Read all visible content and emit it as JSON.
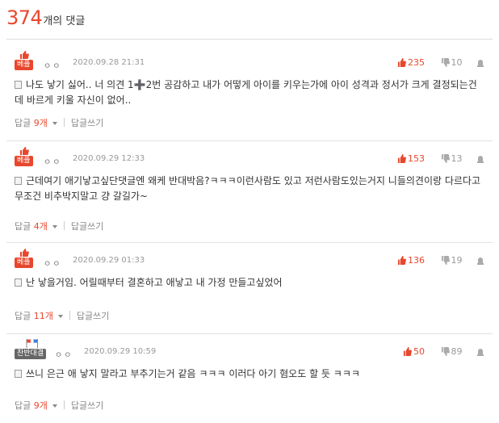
{
  "header": {
    "count": "374",
    "count_label": "개의 댓글"
  },
  "colors": {
    "accent": "#e8472d",
    "muted": "#999999"
  },
  "comments": [
    {
      "badge": "베플",
      "badge_type": "best",
      "badge_icon": "thumbs-up-icon",
      "author": "ㅇㅇ",
      "date": "2020.09.28 21:31",
      "likes": "235",
      "dislikes": "10",
      "text": "나도 낳기 싫어.. 너 의견 1➕2번 공감하고 내가 어떻게 아이를 키우는가에 아이 성격과 정서가 크게 결정되는건데 바르게 키울 자신이 없어..",
      "reply_label": "답글",
      "reply_count": "9개",
      "write_reply": "답글쓰기"
    },
    {
      "badge": "베플",
      "badge_type": "best",
      "badge_icon": "thumbs-up-icon",
      "author": "ㅇㅇ",
      "date": "2020.09.29 12:33",
      "likes": "153",
      "dislikes": "13",
      "text": "근데여기 애기낳고싶단댓글엔 왜케 반대박음?ㅋㅋㅋ이런사람도 있고 저런사람도있는거지 니들의견이랑 다르다고 무조건 비추박지말고 걍 갈길가~",
      "reply_label": "답글",
      "reply_count": "4개",
      "write_reply": "답글쓰기"
    },
    {
      "badge": "베플",
      "badge_type": "best",
      "badge_icon": "thumbs-up-icon",
      "author": "ㅇㅇ",
      "date": "2020.09.29 01:33",
      "likes": "136",
      "dislikes": "19",
      "text": "난 낳을거임. 어릴때부터 결혼하고 애낳고 내 가정 만들고싶었어",
      "reply_label": "답글",
      "reply_count": "11개",
      "write_reply": "답글쓰기"
    },
    {
      "badge": "찬반대결",
      "badge_type": "versus",
      "badge_icon": "flag-icon",
      "author": "ㅇㅇ",
      "date": "2020.09.29 10:59",
      "likes": "50",
      "dislikes": "89",
      "text": "쓰니 은근 애 낳지 말라고 부추기는거 같음 ㅋㅋㅋ 이러다 아기 혐오도 할 듯 ㅋㅋㅋ",
      "reply_label": "답글",
      "reply_count": "9개",
      "write_reply": "답글쓰기"
    }
  ]
}
